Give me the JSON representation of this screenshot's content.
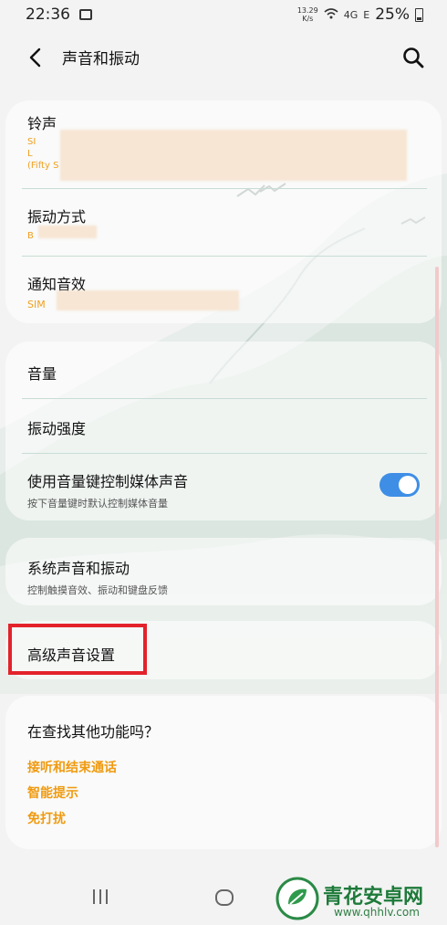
{
  "status_bar": {
    "time": "22:36",
    "net_speed_top": "13.29",
    "net_speed_unit": "K/s",
    "signal1": "4G",
    "signal2": "E",
    "battery": "25%"
  },
  "header": {
    "title": "声音和振动",
    "back_icon": "chevron-left-icon",
    "search_icon": "search-icon"
  },
  "group1": {
    "ringtone": {
      "label": "铃声",
      "sub1": "SI",
      "sub2": "L",
      "sub3": "(Fifty S"
    },
    "vibration_pattern": {
      "label": "振动方式",
      "sub": "B"
    },
    "notification_sound": {
      "label": "通知音效",
      "sub": "SIM"
    }
  },
  "group2": {
    "volume": {
      "label": "音量"
    },
    "vibration_intensity": {
      "label": "振动强度"
    },
    "media_volume_key": {
      "label": "使用音量键控制媒体声音",
      "sub": "按下音量键时默认控制媒体音量",
      "enabled": true
    }
  },
  "group3": {
    "system_sound": {
      "label": "系统声音和振动",
      "sub": "控制触摸音效、振动和键盘反馈"
    }
  },
  "group4": {
    "advanced": {
      "label": "高级声音设置"
    }
  },
  "suggestions": {
    "title": "在查找其他功能吗？",
    "links": [
      "接听和结束通话",
      "智能提示",
      "免打扰"
    ]
  },
  "colors": {
    "accent_orange": "#f09a10",
    "toggle_blue": "#3e8ee6",
    "highlight_red": "#e3222b"
  },
  "watermark": {
    "name": "青花安卓网",
    "url": "www.qhhlv.com"
  }
}
